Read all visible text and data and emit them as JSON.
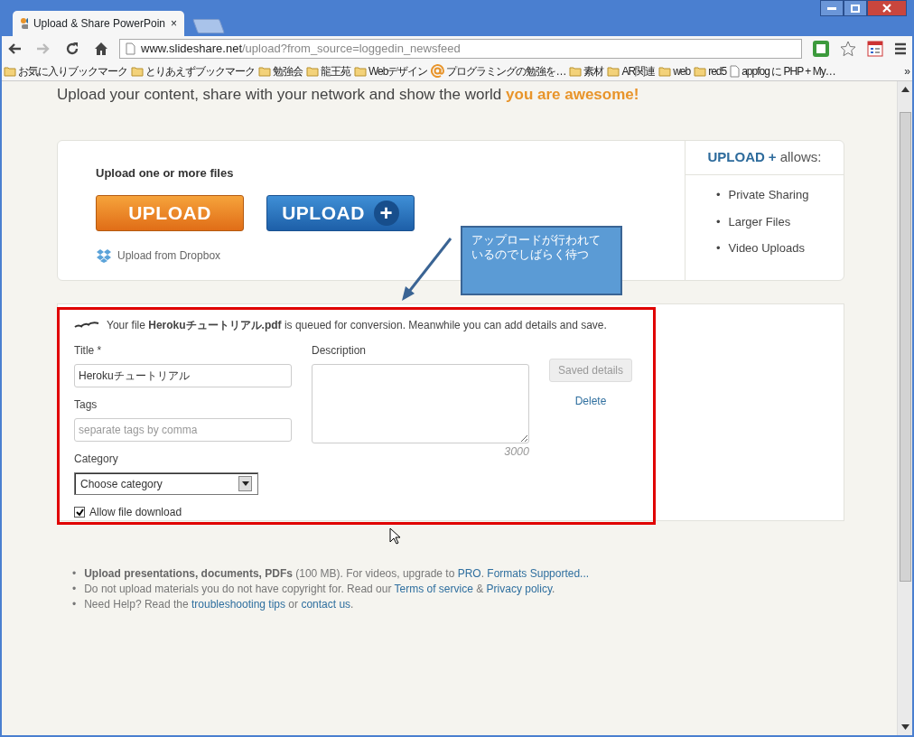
{
  "browser": {
    "tabs": [
      {
        "title": "Upload & Share PowerPoin",
        "close": "×",
        "selected": true
      }
    ],
    "nav": [
      {
        "kind": "back",
        "disabled": false
      },
      {
        "kind": "forward",
        "disabled": true
      },
      {
        "kind": "reload",
        "disabled": false
      },
      {
        "kind": "home",
        "disabled": false
      }
    ],
    "address": {
      "host": "www.slideshare.net",
      "path": "/upload?from_source=loggedin_newsfeed"
    },
    "bookmarks": [
      {
        "kind": "folder",
        "label": "お気に入りブックマーク"
      },
      {
        "kind": "folder",
        "label": "とりあえずブックマーク"
      },
      {
        "kind": "folder",
        "label": "勉強会"
      },
      {
        "kind": "folder",
        "label": "龍王苑"
      },
      {
        "kind": "folder",
        "label": "Webデザイン"
      },
      {
        "kind": "at",
        "label": "プログラミングの勉強を…"
      },
      {
        "kind": "folder",
        "label": "素材"
      },
      {
        "kind": "folder",
        "label": "AR関連"
      },
      {
        "kind": "folder",
        "label": "web"
      },
      {
        "kind": "folder",
        "label": "red5"
      },
      {
        "kind": "page",
        "label": "appfog に PHP + My…"
      }
    ],
    "bookmarks_more": "»"
  },
  "page": {
    "tagline": "Upload your content, share with your network and show the world **you are awesome!**",
    "upload": {
      "heading": "Upload one or more files",
      "buttons": [
        {
          "kind": "basic",
          "label": "UPLOAD"
        },
        {
          "kind": "plus",
          "label": "UPLOAD",
          "badge": "+"
        }
      ],
      "dropbox": "Upload from Dropbox"
    },
    "plus_panel": {
      "title": "UPLOAD",
      "plus": "+",
      "suffix": "allows:",
      "marker": "•",
      "features": [
        "Private Sharing",
        "Larger Files",
        "Video Uploads"
      ]
    },
    "details": {
      "message": "Your file **Herokuチュートリアル.pdf** is queued for conversion. Meanwhile you can add details and save.",
      "title": {
        "label": "Title *",
        "value": "Herokuチュートリアル"
      },
      "tags": {
        "label": "Tags",
        "placeholder": "separate tags by comma"
      },
      "category": {
        "label": "Category",
        "value": "Choose category"
      },
      "allow_download": {
        "label": "Allow file download",
        "checked": true
      },
      "description": {
        "label": "Description",
        "counter": "3000"
      },
      "save": {
        "label": "Saved details",
        "disabled": true
      },
      "delete": "Delete"
    },
    "notes_marker": "•",
    "notes": [
      [
        {
          "kind": "text",
          "text": "**Upload presentations, documents, PDFs** (100 MB). For videos, upgrade to "
        },
        {
          "kind": "link",
          "text": "PRO"
        },
        {
          "kind": "text",
          "text": ". "
        },
        {
          "kind": "link",
          "text": "Formats Supported..."
        }
      ],
      [
        {
          "kind": "text",
          "text": "Do not upload materials you do not have copyright for. Read our "
        },
        {
          "kind": "link",
          "text": "Terms of service"
        },
        {
          "kind": "text",
          "text": " & "
        },
        {
          "kind": "link",
          "text": "Privacy policy"
        },
        {
          "kind": "text",
          "text": "."
        }
      ],
      [
        {
          "kind": "text",
          "text": "Need Help? Read the "
        },
        {
          "kind": "link",
          "text": "troubleshooting tips"
        },
        {
          "kind": "text",
          "text": " or "
        },
        {
          "kind": "link",
          "text": "contact us"
        },
        {
          "kind": "text",
          "text": "."
        }
      ]
    ]
  },
  "annotation": {
    "text": "アップロードが行われているのでしばらく待つ"
  }
}
